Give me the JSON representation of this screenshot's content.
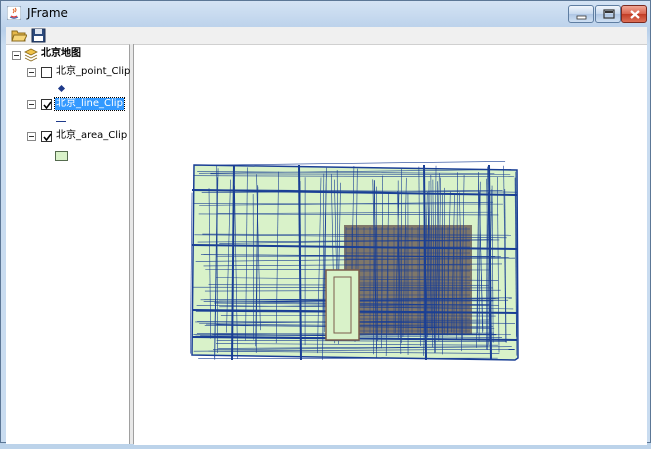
{
  "window": {
    "title": "JFrame"
  },
  "toolbar": {
    "open_icon": "folder-open-icon",
    "save_icon": "floppy-disk-icon"
  },
  "toc": {
    "root": {
      "label": "北京地图",
      "expanded": true
    },
    "layers": [
      {
        "label": "北京_point_Clip",
        "checked": false,
        "symbol": "point",
        "selected": false
      },
      {
        "label": "北京_line_Clip",
        "checked": true,
        "symbol": "line",
        "selected": true
      },
      {
        "label": "北京_area_Clip",
        "checked": true,
        "symbol": "area",
        "selected": false
      }
    ]
  },
  "colors": {
    "selection": "#3399ff",
    "line_symbol": "#1f3a8a",
    "area_fill": "#d9f2c9",
    "map_roads": "#1a3f95",
    "map_dense_area": "#6e6258"
  }
}
